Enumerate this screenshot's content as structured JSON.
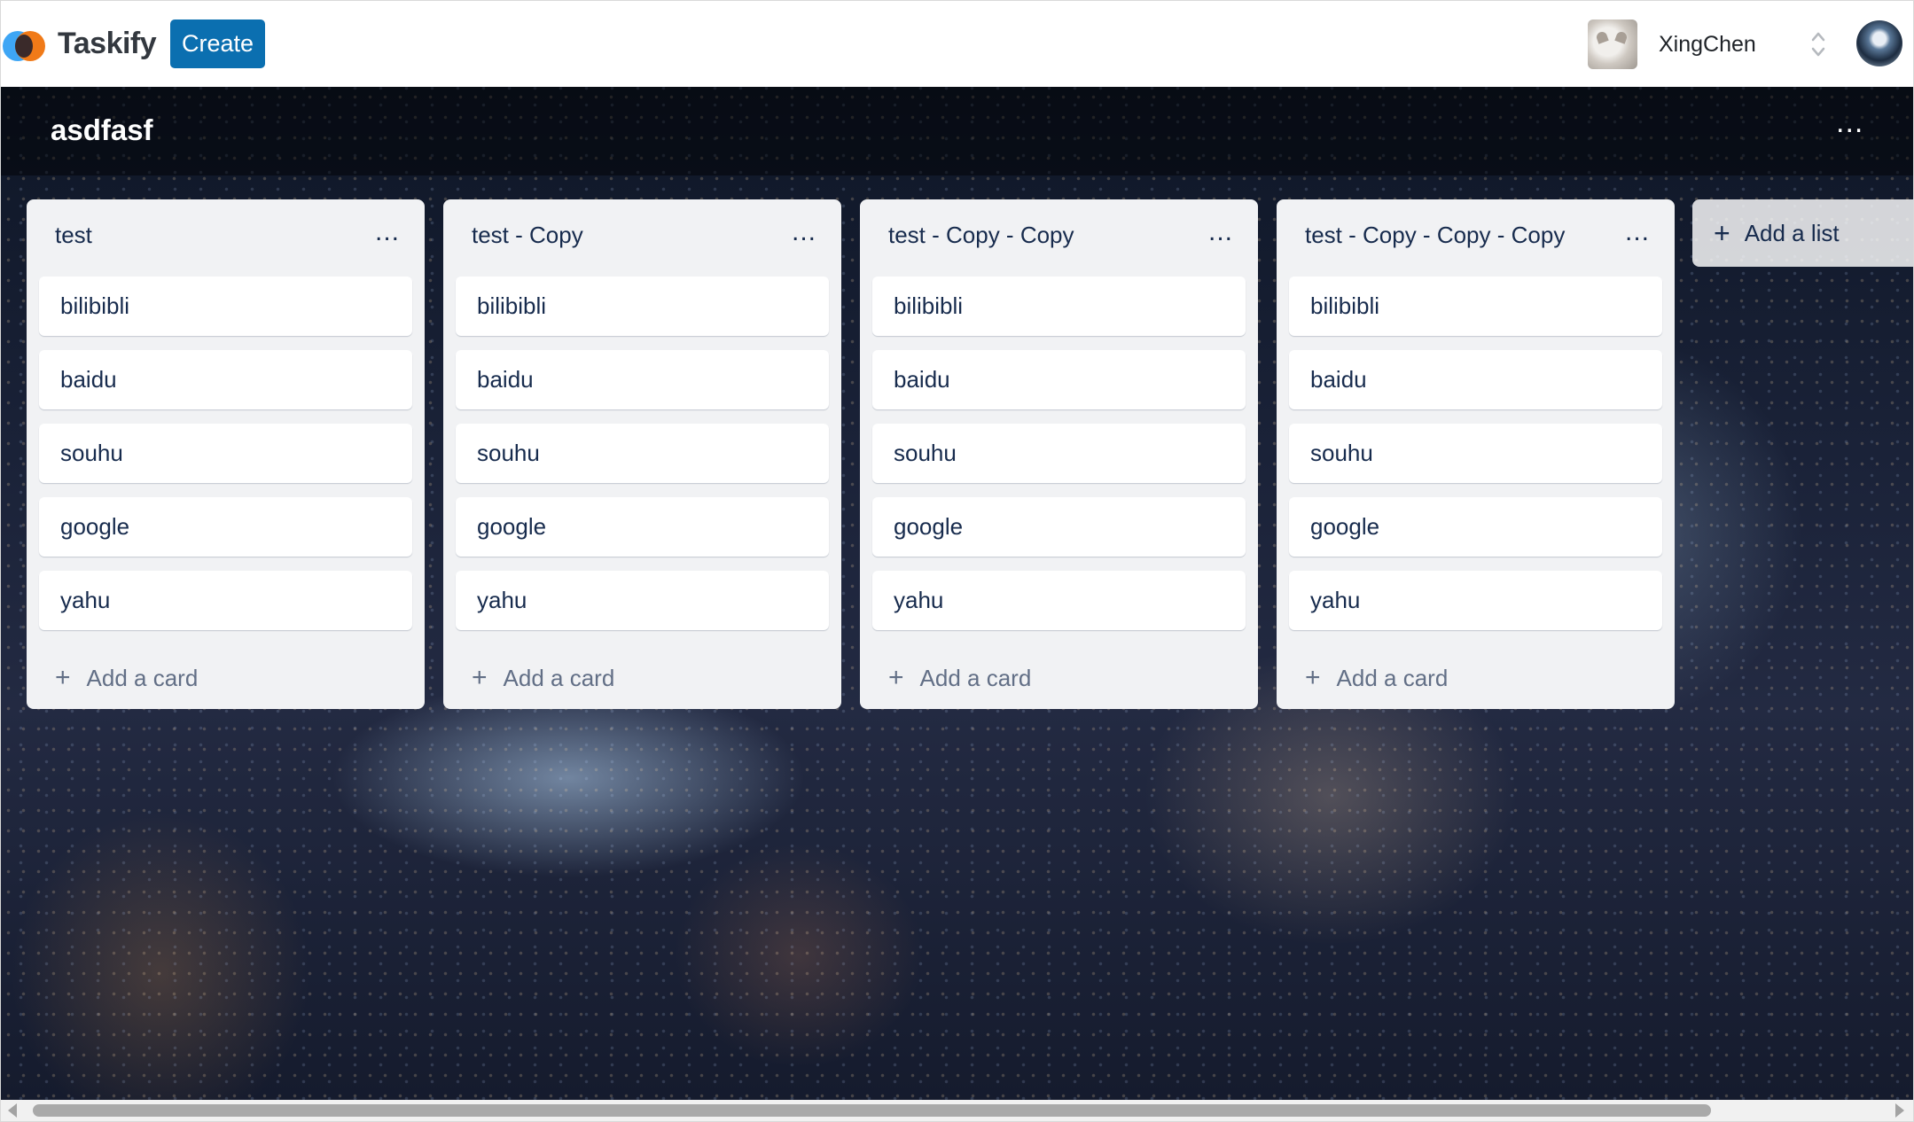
{
  "app": {
    "name": "Taskify",
    "create_label": "Create"
  },
  "org": {
    "name": "XingChen"
  },
  "board": {
    "title": "asdfasf",
    "more_label": "..."
  },
  "lists": [
    {
      "title": "test",
      "cards": [
        "bilibibli",
        "baidu",
        "souhu",
        "google",
        "yahu"
      ],
      "add_card_label": "Add a card",
      "menu_label": "..."
    },
    {
      "title": "test - Copy",
      "cards": [
        "bilibibli",
        "baidu",
        "souhu",
        "google",
        "yahu"
      ],
      "add_card_label": "Add a card",
      "menu_label": "..."
    },
    {
      "title": "test - Copy - Copy",
      "cards": [
        "bilibibli",
        "baidu",
        "souhu",
        "google",
        "yahu"
      ],
      "add_card_label": "Add a card",
      "menu_label": "..."
    },
    {
      "title": "test - Copy - Copy - Copy",
      "cards": [
        "bilibibli",
        "baidu",
        "souhu",
        "google",
        "yahu"
      ],
      "add_card_label": "Add a card",
      "menu_label": "..."
    }
  ],
  "add_list_label": "Add a list",
  "icons": {
    "plus": "+",
    "chevron": "up-down-chevron-icon"
  },
  "colors": {
    "create_button": "#0b6fb0",
    "list_background": "#f1f2f4",
    "card_text": "#172b4d"
  }
}
